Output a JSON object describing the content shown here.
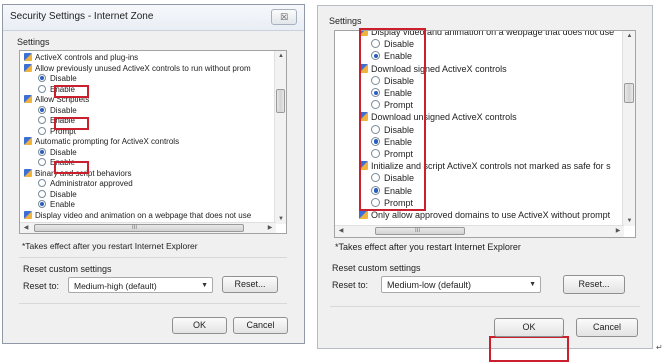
{
  "left": {
    "title": "Security Settings - Internet Zone",
    "close_label": "☒",
    "settings_label": "Settings",
    "items": [
      {
        "type": "header",
        "text": "ActiveX controls and plug-ins"
      },
      {
        "type": "header",
        "text": "Allow previously unused ActiveX controls to run without prom"
      },
      {
        "type": "radio",
        "text": "Disable",
        "checked": true
      },
      {
        "type": "radio",
        "text": "Enable",
        "checked": false
      },
      {
        "type": "header",
        "text": "Allow Scriptlets"
      },
      {
        "type": "radio",
        "text": "Disable",
        "checked": true
      },
      {
        "type": "radio",
        "text": "Enable",
        "checked": false
      },
      {
        "type": "radio",
        "text": "Prompt",
        "checked": false
      },
      {
        "type": "header",
        "text": "Automatic prompting for ActiveX controls"
      },
      {
        "type": "radio",
        "text": "Disable",
        "checked": true
      },
      {
        "type": "radio",
        "text": "Enable",
        "checked": false
      },
      {
        "type": "header",
        "text": "Binary and script behaviors"
      },
      {
        "type": "radio",
        "text": "Administrator approved",
        "checked": false
      },
      {
        "type": "radio",
        "text": "Disable",
        "checked": false
      },
      {
        "type": "radio",
        "text": "Enable",
        "checked": true
      },
      {
        "type": "header",
        "text": "Display video and animation on a webpage that does not use"
      }
    ],
    "hscroll_mark": "III",
    "note": "*Takes effect after you restart Internet Explorer",
    "reset_group_label": "Reset custom settings",
    "reset_to_label": "Reset to:",
    "reset_value": "Medium-high (default)",
    "reset_button": "Reset...",
    "ok": "OK",
    "cancel": "Cancel"
  },
  "right": {
    "settings_label": "Settings",
    "items": [
      {
        "type": "header",
        "text": "Display video and animation on a webpage that does not use"
      },
      {
        "type": "radio",
        "text": "Disable",
        "checked": false
      },
      {
        "type": "radio",
        "text": "Enable",
        "checked": true
      },
      {
        "type": "header",
        "text": "Download signed ActiveX controls"
      },
      {
        "type": "radio",
        "text": "Disable",
        "checked": false
      },
      {
        "type": "radio",
        "text": "Enable",
        "checked": true
      },
      {
        "type": "radio",
        "text": "Prompt",
        "checked": false
      },
      {
        "type": "header",
        "text": "Download unsigned ActiveX controls"
      },
      {
        "type": "radio",
        "text": "Disable",
        "checked": false
      },
      {
        "type": "radio",
        "text": "Enable",
        "checked": true
      },
      {
        "type": "radio",
        "text": "Prompt",
        "checked": false
      },
      {
        "type": "header",
        "text": "Initialize and script ActiveX controls not marked as safe for s"
      },
      {
        "type": "radio",
        "text": "Disable",
        "checked": false
      },
      {
        "type": "radio",
        "text": "Enable",
        "checked": true
      },
      {
        "type": "radio",
        "text": "Prompt",
        "checked": false
      },
      {
        "type": "header",
        "text": "Only allow approved domains to use ActiveX without prompt"
      }
    ],
    "hscroll_mark": "III",
    "note": "*Takes effect after you restart Internet Explorer",
    "reset_group_label": "Reset custom settings",
    "reset_to_label": "Reset to:",
    "reset_value": "Medium-low (default)",
    "reset_button": "Reset...",
    "ok": "OK",
    "cancel": "Cancel"
  },
  "colors": {
    "highlight": "#cc1f2d",
    "accent": "#2a5fbf"
  },
  "corner_mark": "↵"
}
